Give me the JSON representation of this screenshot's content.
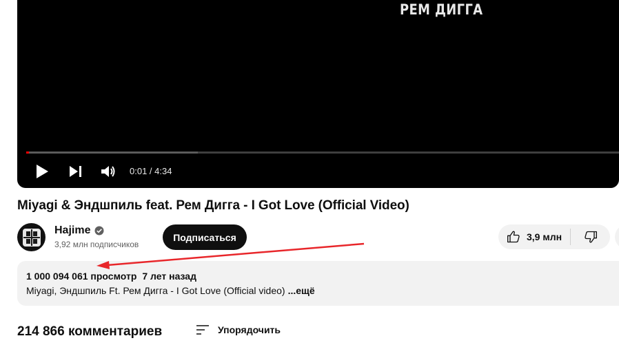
{
  "player": {
    "overlay_text": "РЕМ ДИГГА",
    "progress_played": 0.005,
    "progress_buffered": 0.29,
    "current_time": "0:01",
    "time_separator": " / ",
    "duration": "4:34",
    "icons": [
      "play-icon",
      "next-icon",
      "volume-icon"
    ]
  },
  "video": {
    "title": "Miyagi & Эндшпиль feat. Рем Дигга - I Got Love (Official Video)"
  },
  "channel": {
    "name": "Hajime",
    "subscribers": "3,92 млн подписчиков",
    "subscribe_label": "Подписаться"
  },
  "actions": {
    "likes": "3,9 млн"
  },
  "description": {
    "views": "1 000 094 061 просмотр",
    "age": "7 лет назад",
    "text": "Miyagi, Эндшпиль Ft. Рем Дигга - I Got Love (Official video)",
    "more_label": "...ещё"
  },
  "comments": {
    "count": "214 866 комментариев",
    "sort_label": "Упорядочить"
  },
  "annotation": {
    "arrow_color": "#e8262a"
  }
}
